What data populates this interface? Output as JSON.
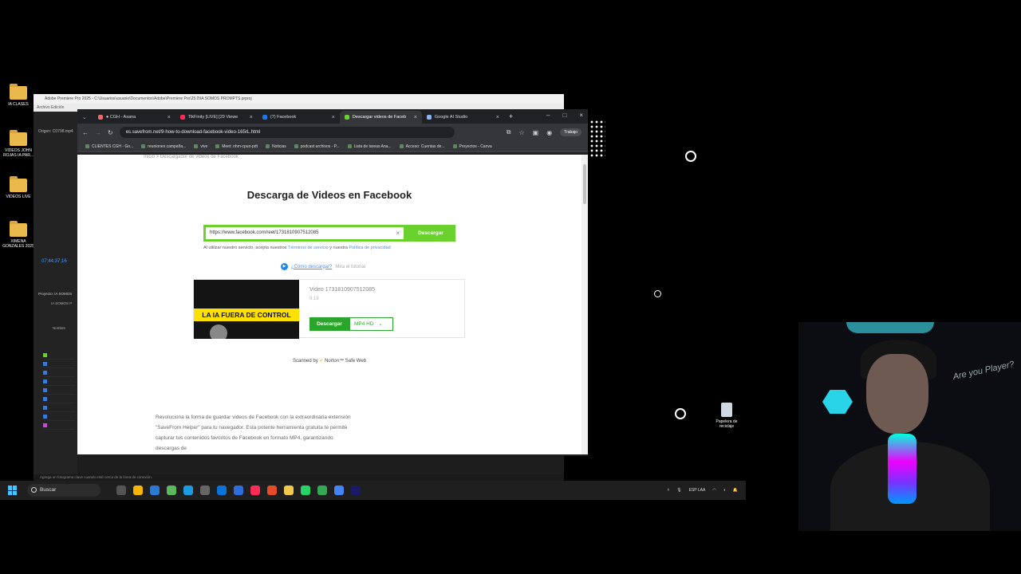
{
  "desktop": {
    "icons": [
      {
        "label": "IA CLASES"
      },
      {
        "label": "VIDEOS JOHN ROJAS IA PAR..."
      },
      {
        "label": "VIDEOS LIVE"
      },
      {
        "label": "XIMENA GONZALES 2025"
      }
    ],
    "recycle_bin": "Papelera de reciclaje"
  },
  "premiere": {
    "title": "Adobe Premiere Pro 2025 - C:\\Usuarios\\usuario\\Documentos\\Adobe\\Premiere Pro\\25.0\\IA SOMOS PROMPTS.prproj",
    "menu": "Archivo   Edición",
    "origin": "Origen: C0798.mp4",
    "timecode": "07;44;37;16",
    "project_label": "Proyecto: IA SOMOS",
    "project_sub": "IA SOMOS P",
    "name_col": "Nombre",
    "footer": "Agrega un fotograma clave cuando esté cerca de la línea de conexión."
  },
  "chrome": {
    "tabs": [
      {
        "label": "● CGH - Asana",
        "color": "#f06a6a"
      },
      {
        "label": "TikFinity [LIVE] [29 Viewe",
        "color": "#ff2d55"
      },
      {
        "label": "(7) Facebook",
        "color": "#1877f2"
      },
      {
        "label": "Descargar videos de Faceb",
        "color": "#6bd12c"
      },
      {
        "label": "Google AI Studio",
        "color": "#8ab4f8"
      }
    ],
    "url": "es.savefrom.net/9-how-to-download-facebook-video-165rL.html",
    "profile": "Trabajo",
    "bookmarks": [
      "CLIENTES CGH - Go...",
      "reuniones campaña...",
      "vive",
      "Meet: nhm-cpuo-pdt",
      "Noticias",
      "podcast archivos - P...",
      "Lista de tareas Ana...",
      "Acceso: Cuentas de...",
      "Proyectos - Canva"
    ]
  },
  "page": {
    "breadcrumb": "Inicio  >  Descargador de videos de Facebook",
    "heading": "Descarga de Videos en Facebook",
    "url_value": "https://www.facebook.com/reel/1731810907512085",
    "download_button": "Descargar",
    "terms_prefix": "Al utilizar nuestro servicio, acepta nuestros",
    "terms_link": "Términos de servicio",
    "terms_mid": "y nuestra",
    "privacy_link": "Política de privacidad",
    "howto_link": "¿Cómo descargar?",
    "howto_muted": "Mira el tutorial",
    "thumbnail_text": "LA IA FUERA DE CONTROL",
    "video_title": "Video 1731810907512085",
    "video_duration": "9:18",
    "result_download": "Descargar",
    "format": "MP4  HD",
    "scanned_prefix": "Scanned by",
    "scanned_brand": "Norton™ Safe Web",
    "paragraph": "Revoluciona la forma de guardar videos de Facebook con la extraordinaria extensión \"SaveFrom Helper\" para tu navegador. Esta potente herramienta gratuita te permite capturar tus contenidos favoritos de Facebook en formato MP4, garantizando descargas de"
  },
  "taskbar": {
    "search": "Buscar",
    "lang": "ESP LAA"
  },
  "webcam": {
    "sign_text": "Are you Player?"
  }
}
